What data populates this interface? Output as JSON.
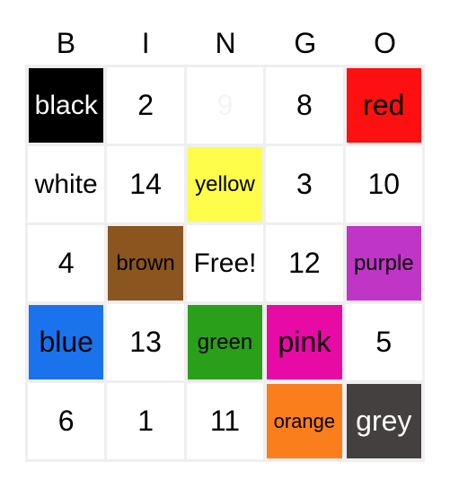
{
  "header": [
    "B",
    "I",
    "N",
    "G",
    "O"
  ],
  "cells": [
    {
      "text": "black",
      "bg": "#000000",
      "fg": "#ffffff",
      "size": "word"
    },
    {
      "text": "2",
      "bg": "#ffffff",
      "fg": "#000000",
      "size": ""
    },
    {
      "text": "9",
      "bg": "#ffffff",
      "fg": "#f4f4f4",
      "size": "faded"
    },
    {
      "text": "8",
      "bg": "#ffffff",
      "fg": "#000000",
      "size": ""
    },
    {
      "text": "red",
      "bg": "#fe1010",
      "fg": "#000000",
      "size": ""
    },
    {
      "text": "white",
      "bg": "#ffffff",
      "fg": "#000000",
      "size": "word"
    },
    {
      "text": "14",
      "bg": "#ffffff",
      "fg": "#000000",
      "size": ""
    },
    {
      "text": "yellow",
      "bg": "#fdfd4a",
      "fg": "#000000",
      "size": "small"
    },
    {
      "text": "3",
      "bg": "#ffffff",
      "fg": "#000000",
      "size": ""
    },
    {
      "text": "10",
      "bg": "#ffffff",
      "fg": "#000000",
      "size": ""
    },
    {
      "text": "4",
      "bg": "#ffffff",
      "fg": "#000000",
      "size": ""
    },
    {
      "text": "brown",
      "bg": "#8b5520",
      "fg": "#000000",
      "size": "small"
    },
    {
      "text": "Free!",
      "bg": "#ffffff",
      "fg": "#000000",
      "size": "word"
    },
    {
      "text": "12",
      "bg": "#ffffff",
      "fg": "#000000",
      "size": ""
    },
    {
      "text": "purple",
      "bg": "#bf36c6",
      "fg": "#000000",
      "size": "small"
    },
    {
      "text": "blue",
      "bg": "#1a73ec",
      "fg": "#000000",
      "size": ""
    },
    {
      "text": "13",
      "bg": "#ffffff",
      "fg": "#000000",
      "size": ""
    },
    {
      "text": "green",
      "bg": "#2aa01a",
      "fg": "#000000",
      "size": "small"
    },
    {
      "text": "pink",
      "bg": "#e80aa4",
      "fg": "#000000",
      "size": ""
    },
    {
      "text": "5",
      "bg": "#ffffff",
      "fg": "#000000",
      "size": ""
    },
    {
      "text": "6",
      "bg": "#ffffff",
      "fg": "#000000",
      "size": ""
    },
    {
      "text": "1",
      "bg": "#ffffff",
      "fg": "#000000",
      "size": ""
    },
    {
      "text": "11",
      "bg": "#ffffff",
      "fg": "#000000",
      "size": ""
    },
    {
      "text": "orange",
      "bg": "#fb7e1c",
      "fg": "#000000",
      "size": "xsmall"
    },
    {
      "text": "grey",
      "bg": "#444040",
      "fg": "#ffffff",
      "size": ""
    }
  ]
}
